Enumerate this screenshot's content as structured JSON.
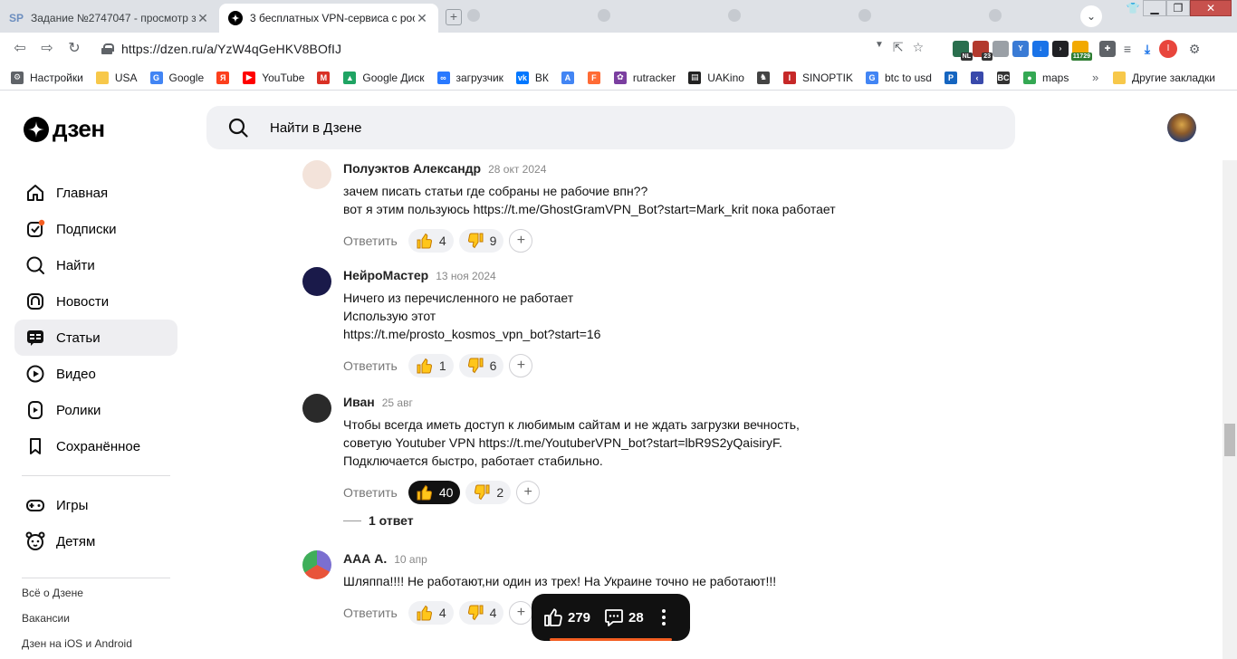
{
  "browser": {
    "tabs": [
      {
        "favicon": "SP",
        "title": "Задание №2747047 - просмотр з"
      },
      {
        "favicon": "dzen-icon",
        "title": "3 бесплатных VPN-сервиса с рос"
      }
    ],
    "new_tab": "+",
    "url": "https://dzen.ru/a/YzW4qGeHKV8BOfIJ",
    "extensions": {
      "nl_badge": "NL",
      "count_badge": "23",
      "wallet_badge": "11729",
      "profile_letter": "I"
    },
    "bookmarks": [
      {
        "icon": "gear-icon",
        "label": "Настройки"
      },
      {
        "icon": "folder-icon",
        "label": "USA"
      },
      {
        "icon": "google-icon",
        "label": "Google"
      },
      {
        "icon": "yandex-icon",
        "label": ""
      },
      {
        "icon": "youtube-icon",
        "label": "YouTube"
      },
      {
        "icon": "gmail-icon",
        "label": ""
      },
      {
        "icon": "google-drive-icon",
        "label": "Google Диск"
      },
      {
        "icon": "infinity-icon",
        "label": "загрузчик"
      },
      {
        "icon": "vk-icon",
        "label": "ВК"
      },
      {
        "icon": "translate-icon",
        "label": ""
      },
      {
        "icon": "f-icon",
        "label": ""
      },
      {
        "icon": "rutracker-icon",
        "label": "rutracker"
      },
      {
        "icon": "uakino-icon",
        "label": "UAKino"
      },
      {
        "icon": "chess-icon",
        "label": ""
      },
      {
        "icon": "thermometer-icon",
        "label": "SINOPTIK"
      },
      {
        "icon": "google-icon",
        "label": "btc to usd"
      },
      {
        "icon": "p-icon",
        "label": ""
      },
      {
        "icon": "arrow-icon",
        "label": ""
      },
      {
        "icon": "bc-icon",
        "label": ""
      },
      {
        "icon": "maps-icon",
        "label": "maps"
      }
    ],
    "bookmarks_more": "»",
    "other_bookmarks": "Другие закладки"
  },
  "header": {
    "logo": "дзен",
    "search_placeholder": "Найти в Дзене"
  },
  "sidebar": {
    "items": [
      {
        "label": "Главная",
        "icon": "home-icon",
        "active": false
      },
      {
        "label": "Подписки",
        "icon": "subscriptions-icon",
        "active": false
      },
      {
        "label": "Найти",
        "icon": "search-icon",
        "active": false
      },
      {
        "label": "Новости",
        "icon": "news-icon",
        "active": false
      },
      {
        "label": "Статьи",
        "icon": "articles-icon",
        "active": true
      },
      {
        "label": "Видео",
        "icon": "video-icon",
        "active": false
      },
      {
        "label": "Ролики",
        "icon": "shorts-icon",
        "active": false
      },
      {
        "label": "Сохранённое",
        "icon": "bookmark-icon",
        "active": false
      }
    ],
    "items2": [
      {
        "label": "Игры",
        "icon": "gamepad-icon"
      },
      {
        "label": "Детям",
        "icon": "kids-icon"
      }
    ],
    "links": [
      "Всё о Дзене",
      "Вакансии",
      "Дзен на iOS и Android"
    ]
  },
  "comments": [
    {
      "author": "Полуэктов Александр",
      "date": "28 окт 2024",
      "lines": [
        "зачем писать статьи где собраны не рабочие впн??",
        "вот я этим пользуюсь https://t.me/GhostGramVPN_Bot?start=Mark_krit пока работает"
      ],
      "reply": "Ответить",
      "likes": "4",
      "dislikes": "9",
      "liked": false,
      "avatar_color": "#f3e3da"
    },
    {
      "author": "НейроМастер",
      "date": "13 ноя 2024",
      "lines": [
        "Ничего из перечисленного не работает",
        "Использую этот",
        "https://t.me/prosto_kosmos_vpn_bot?start=16"
      ],
      "reply": "Ответить",
      "likes": "1",
      "dislikes": "6",
      "liked": false,
      "avatar_color": "#1a1a4a"
    },
    {
      "author": "Иван",
      "date": "25 авг",
      "lines": [
        "Чтобы всегда иметь доступ к любимым сайтам и не ждать загрузки вечность,",
        "советую Youtuber VPN https://t.me/YoutuberVPN_bot?start=lbR9S2yQaisiryF.",
        "Подключается быстро, работает стабильно."
      ],
      "reply": "Ответить",
      "likes": "40",
      "dislikes": "2",
      "liked": true,
      "replies": "1 ответ",
      "avatar_color": "#2a2a2a"
    },
    {
      "author": "ААА А.",
      "date": "10 апр",
      "lines": [
        "Шляппа!!!! Не работают,ни один из трех! На Украине точно не работают!!!"
      ],
      "reply": "Ответить",
      "likes": "4",
      "dislikes": "4",
      "liked": false,
      "avatar_color": "#7b6fd0"
    }
  ],
  "floatbar": {
    "likes": "279",
    "comments": "28"
  },
  "colors": {
    "accent_orange": "#f45e22",
    "sidebar_active": "#eeeef1"
  }
}
